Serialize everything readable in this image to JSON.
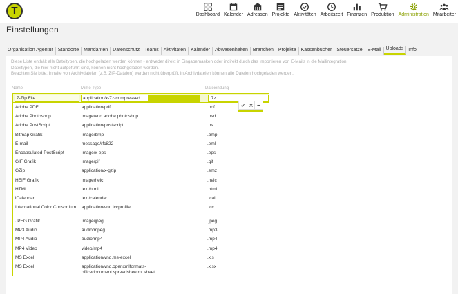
{
  "app": {
    "logo_letter": "T"
  },
  "nav": [
    {
      "name": "dashboard",
      "label": "Dashboard",
      "icon": "grid-icon"
    },
    {
      "name": "kalender",
      "label": "Kalender",
      "icon": "calendar-icon"
    },
    {
      "name": "adressen",
      "label": "Adressen",
      "icon": "building-icon"
    },
    {
      "name": "projekte",
      "label": "Projekte",
      "icon": "folder-icon"
    },
    {
      "name": "aktivitaeten",
      "label": "Aktivitäten",
      "icon": "check-circle-icon"
    },
    {
      "name": "arbeitszeit",
      "label": "Arbeitszeit",
      "icon": "clock-icon"
    },
    {
      "name": "finanzen",
      "label": "Finanzen",
      "icon": "bar-chart-icon"
    },
    {
      "name": "produktion",
      "label": "Produktion",
      "icon": "cart-icon"
    },
    {
      "name": "administration",
      "label": "Administration",
      "icon": "gear-icon",
      "active": true
    },
    {
      "name": "mitarbeiter",
      "label": "Mitarbeiter",
      "icon": "people-icon"
    }
  ],
  "page": {
    "title": "Einstellungen"
  },
  "tabs": [
    "Organisation Agentur",
    "Standorte",
    "Mandanten",
    "Datenschutz",
    "Teams",
    "Aktivitäten",
    "Kalender",
    "Abwesenheiten",
    "Branchen",
    "Projekte",
    "Kassenbücher",
    "Steuersätze",
    "E-Mail",
    "Uploads",
    "Info"
  ],
  "active_tab": "Uploads",
  "info": {
    "line1": "Diese Liste enthält alle Dateitypen, die hochgeladen werden können - entweder direkt in Eingabemasken oder indirekt durch das Importieren von E-Mails in die Mailintegration.",
    "line2": "Dateitypen, die hier nicht aufgeführt sind, können nicht hochgeladen werden.",
    "line3": "Beachten Sie bitte: Inhalte von Archivdateien (z.B. ZIP-Dateien) werden nicht überprüft, in Archivdateien können alle Dateien hochgeladen werden."
  },
  "table": {
    "headers": {
      "name": "Name",
      "mime": "Mime Type",
      "ext": "Dateiendung"
    },
    "edit": {
      "name": "7-Zip File",
      "mime": "application/x-7z-compressed",
      "ext": ".7z"
    },
    "rows": [
      {
        "name": "Adobe PDF",
        "mime": "application/pdf",
        "ext": ".pdf"
      },
      {
        "name": "Adobe Photoshop",
        "mime": "image/vnd.adobe.photoshop",
        "ext": ".psd"
      },
      {
        "name": "Adobe PostScript",
        "mime": "application/postscript",
        "ext": ".ps"
      },
      {
        "name": "Bitmap Grafik",
        "mime": "image/bmp",
        "ext": ".bmp"
      },
      {
        "name": "E-mail",
        "mime": "message/rfc822",
        "ext": ".eml"
      },
      {
        "name": "Encapsulated PostScript",
        "mime": "image/x-eps",
        "ext": ".eps"
      },
      {
        "name": "GIF Grafik",
        "mime": "image/gif",
        "ext": ".gif"
      },
      {
        "name": "GZip",
        "mime": "application/x-gzip",
        "ext": ".emz"
      },
      {
        "name": "HEIF Grafik",
        "mime": "image/heic",
        "ext": ".heic"
      },
      {
        "name": "HTML",
        "mime": "text/html",
        "ext": ".html"
      },
      {
        "name": "iCalendar",
        "mime": "text/calendar",
        "ext": ".ical"
      },
      {
        "name": "International Color Consortium",
        "mime": "application/vnd.iccprofile",
        "ext": ".icc"
      },
      {
        "name": "JPEG Grafik",
        "mime": "image/jpeg",
        "ext": ".jpeg"
      },
      {
        "name": "MP3 Audio",
        "mime": "audio/mpeg",
        "ext": ".mp3"
      },
      {
        "name": "MP4 Audio",
        "mime": "audio/mp4",
        "ext": ".mp4"
      },
      {
        "name": "MP4 Video",
        "mime": "video/mp4",
        "ext": ".mp4"
      },
      {
        "name": "MS Excel",
        "mime": "application/vnd.ms-excel",
        "ext": ".xls"
      },
      {
        "name": "MS Excel",
        "mime": "application/vnd.openxmlformats-officedocument.spreadsheetml.sheet",
        "ext": ".xlsx"
      }
    ]
  },
  "colors": {
    "accent": "#c8d400",
    "accent_light": "#f4f8d0",
    "active_nav_text": "#8aa000"
  }
}
